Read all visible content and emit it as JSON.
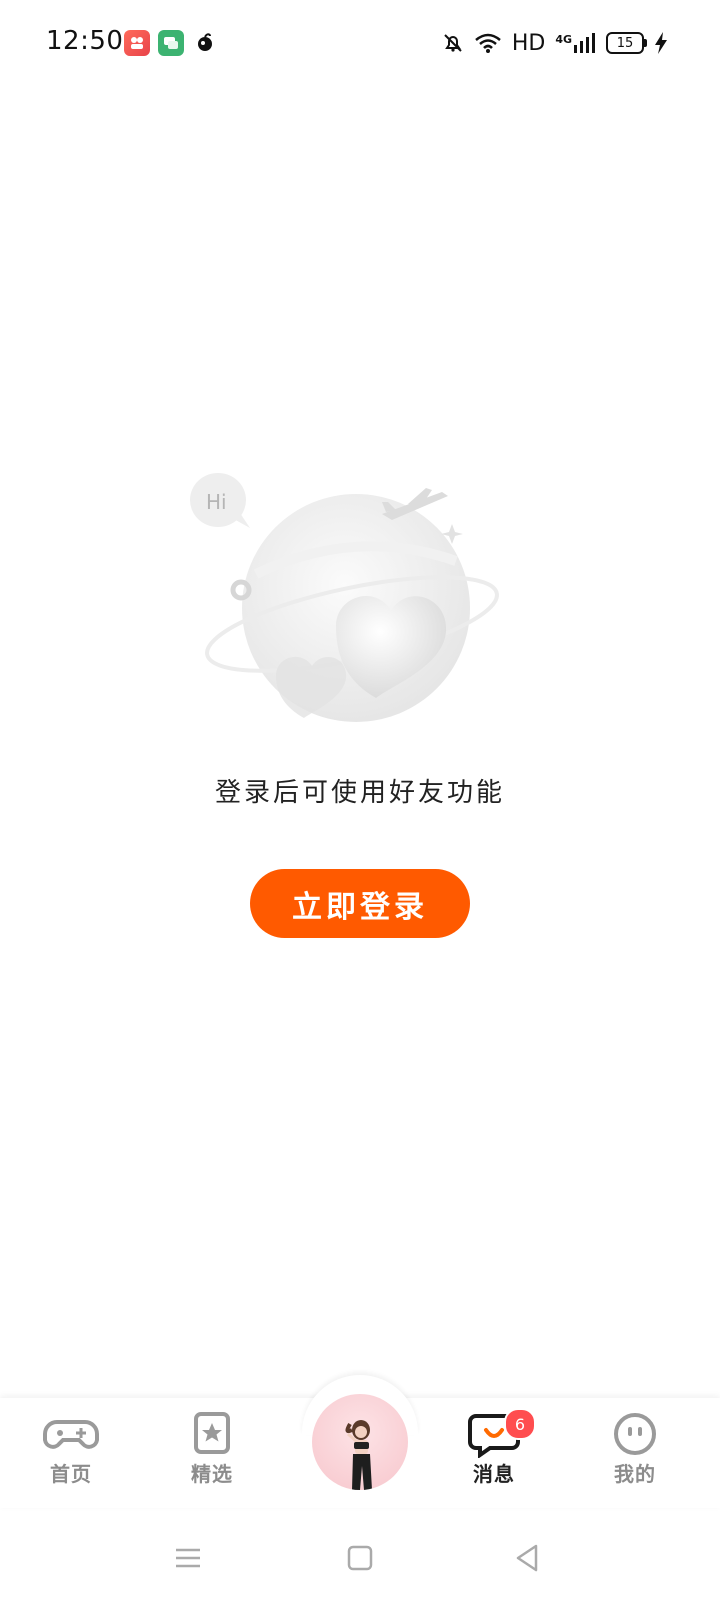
{
  "status_bar": {
    "time": "12:50",
    "notification_icons": [
      "app-notification-icon",
      "chat-notification-icon",
      "peach-notification-icon"
    ],
    "network": "HD",
    "cellular": "4G",
    "battery_level": "15",
    "charging": true
  },
  "empty_state": {
    "bubble_text": "Hi",
    "message": "登录后可使用好友功能",
    "login_button": "立即登录"
  },
  "bottom_nav": {
    "items": [
      {
        "label": "首页",
        "icon": "gamepad-icon",
        "active": false
      },
      {
        "label": "精选",
        "icon": "star-bookmark-icon",
        "active": false
      },
      {
        "label": "",
        "icon": "avatar",
        "active": false
      },
      {
        "label": "消息",
        "icon": "message-bubble-icon",
        "active": true,
        "badge": "6"
      },
      {
        "label": "我的",
        "icon": "face-icon",
        "active": false
      }
    ]
  },
  "colors": {
    "accent": "#ff5a00",
    "badge": "#ff4d4f",
    "inactive": "#8c8c8c"
  }
}
